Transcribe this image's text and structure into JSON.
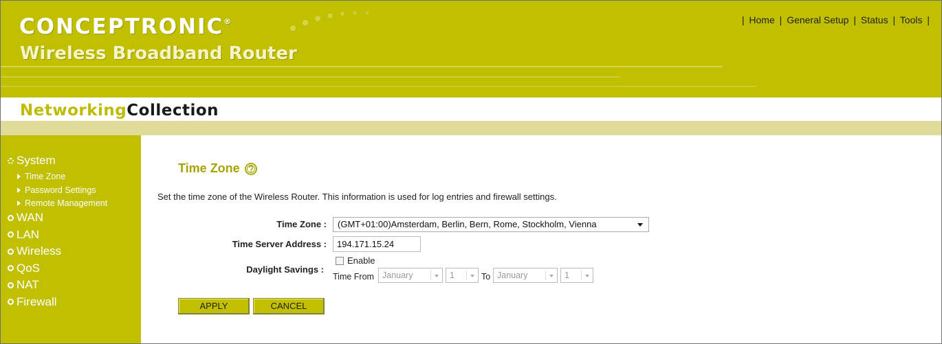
{
  "header": {
    "brand": "CONCEPTRONIC",
    "brand_mark": "®",
    "subtitle": "Wireless Broadband Router",
    "collection_part1": "Networking",
    "collection_part2": "Collection",
    "topnav": [
      {
        "label": "Home"
      },
      {
        "label": "General Setup"
      },
      {
        "label": "Status"
      },
      {
        "label": "Tools"
      }
    ],
    "topnav_sep": "|"
  },
  "sidebar": {
    "system": "System",
    "system_sub": [
      {
        "label": "Time Zone"
      },
      {
        "label": "Password Settings"
      },
      {
        "label": "Remote Management"
      }
    ],
    "items": [
      {
        "label": "WAN"
      },
      {
        "label": "LAN"
      },
      {
        "label": "Wireless"
      },
      {
        "label": "QoS"
      },
      {
        "label": "NAT"
      },
      {
        "label": "Firewall"
      }
    ]
  },
  "main": {
    "title": "Time Zone",
    "help_icon": "help-circle-icon",
    "description": "Set the time zone of the Wireless Router. This information is used for log entries and firewall settings.",
    "time_zone_label": "Time Zone :",
    "time_zone_value": "(GMT+01:00)Amsterdam, Berlin, Bern, Rome, Stockholm, Vienna",
    "server_label": "Time Server Address :",
    "server_value": "194.171.15.24",
    "daylight_label": "Daylight Savings :",
    "enable_label": "Enable",
    "time_from_label": "Time From",
    "to_label": "To",
    "from_month": "January",
    "from_day": "1",
    "to_month": "January",
    "to_day": "1",
    "apply_label": "APPLY",
    "cancel_label": "CANCEL"
  },
  "colors": {
    "primary": "#c0bf00",
    "title": "#a6a500",
    "band": "#dedc98"
  }
}
